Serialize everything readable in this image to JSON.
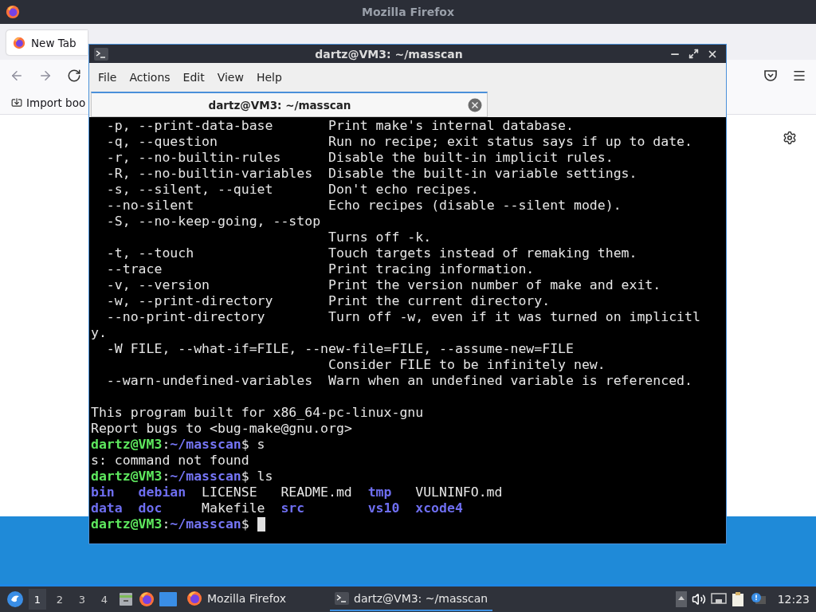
{
  "firefox": {
    "title": "Mozilla Firefox",
    "tabs": [
      {
        "label": "New Tab",
        "selected": true
      }
    ],
    "bookmarks": [
      "Import boo"
    ]
  },
  "terminal": {
    "title": "dartz@VM3: ~/masscan",
    "menu": [
      "File",
      "Actions",
      "Edit",
      "View",
      "Help"
    ],
    "tabs": [
      {
        "label": "dartz@VM3: ~/masscan",
        "selected": true
      }
    ],
    "lines": [
      {
        "kind": "output",
        "text": "  -p, --print-data-base       Print make's internal database."
      },
      {
        "kind": "output",
        "text": "  -q, --question              Run no recipe; exit status says if up to date."
      },
      {
        "kind": "output",
        "text": "  -r, --no-builtin-rules      Disable the built-in implicit rules."
      },
      {
        "kind": "output",
        "text": "  -R, --no-builtin-variables  Disable the built-in variable settings."
      },
      {
        "kind": "output",
        "text": "  -s, --silent, --quiet       Don't echo recipes."
      },
      {
        "kind": "output",
        "text": "  --no-silent                 Echo recipes (disable --silent mode)."
      },
      {
        "kind": "output",
        "text": "  -S, --no-keep-going, --stop"
      },
      {
        "kind": "output",
        "text": "                              Turns off -k."
      },
      {
        "kind": "output",
        "text": "  -t, --touch                 Touch targets instead of remaking them."
      },
      {
        "kind": "output",
        "text": "  --trace                     Print tracing information."
      },
      {
        "kind": "output",
        "text": "  -v, --version               Print the version number of make and exit."
      },
      {
        "kind": "output",
        "text": "  -w, --print-directory       Print the current directory."
      },
      {
        "kind": "output",
        "text": "  --no-print-directory        Turn off -w, even if it was turned on implicitl"
      },
      {
        "kind": "output",
        "text": "y."
      },
      {
        "kind": "output",
        "text": "  -W FILE, --what-if=FILE, --new-file=FILE, --assume-new=FILE"
      },
      {
        "kind": "output",
        "text": "                              Consider FILE to be infinitely new."
      },
      {
        "kind": "output",
        "text": "  --warn-undefined-variables  Warn when an undefined variable is referenced."
      },
      {
        "kind": "blank"
      },
      {
        "kind": "output",
        "text": "This program built for x86_64-pc-linux-gnu"
      },
      {
        "kind": "output",
        "text": "Report bugs to <bug-make@gnu.org>"
      },
      {
        "kind": "prompt",
        "user": "dartz@VM3",
        "separator": ":",
        "path": "~/masscan",
        "command": "$ s",
        "cursor": false
      },
      {
        "kind": "output",
        "text": "s: command not found"
      },
      {
        "kind": "prompt",
        "user": "dartz@VM3",
        "separator": ":",
        "path": "~/masscan",
        "command": "$ ls",
        "cursor": false
      },
      {
        "kind": "listing",
        "entries": [
          {
            "text": "bin",
            "kind": "dir"
          },
          {
            "text": "debian",
            "kind": "dir"
          },
          {
            "text": "LICENSE",
            "kind": "file"
          },
          {
            "text": "README.md",
            "kind": "file"
          },
          {
            "text": "tmp",
            "kind": "dir"
          },
          {
            "text": "VULNINFO.md",
            "kind": "file"
          }
        ]
      },
      {
        "kind": "listing",
        "entries": [
          {
            "text": "data",
            "kind": "dir"
          },
          {
            "text": "doc",
            "kind": "dir"
          },
          {
            "text": "Makefile",
            "kind": "file"
          },
          {
            "text": "src",
            "kind": "dir"
          },
          {
            "text": "vs10",
            "kind": "dir"
          },
          {
            "text": "xcode4",
            "kind": "dir"
          }
        ]
      },
      {
        "kind": "prompt",
        "user": "dartz@VM3",
        "separator": ":",
        "path": "~/masscan",
        "command": "$",
        "cursor": true
      }
    ]
  },
  "taskbar": {
    "workspaces": [
      {
        "label": "1",
        "selected": true
      },
      {
        "label": "2",
        "selected": false
      },
      {
        "label": "3",
        "selected": false
      },
      {
        "label": "4",
        "selected": false
      }
    ],
    "tasks": [
      {
        "label": "Mozilla Firefox",
        "kind": "browser",
        "selected": false
      },
      {
        "label": "dartz@VM3: ~/masscan",
        "kind": "terminal",
        "selected": true
      }
    ],
    "clock": "12:23"
  }
}
